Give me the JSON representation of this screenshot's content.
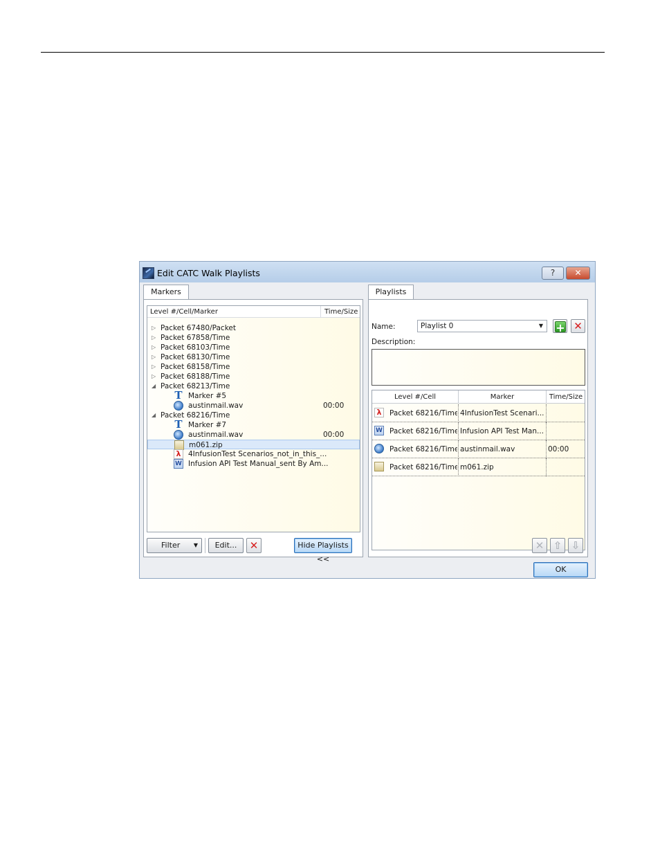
{
  "window": {
    "title": "Edit CATC Walk Playlists",
    "help_label": "?",
    "close_label": "✕"
  },
  "markers_panel": {
    "tab_label": "Markers",
    "columns": [
      "Level #/Cell/Marker",
      "Time/Size"
    ],
    "tree": [
      {
        "label": "Packet 67480/Packet",
        "kind": "collapsed",
        "time": ""
      },
      {
        "label": "Packet 67858/Time",
        "kind": "collapsed",
        "time": ""
      },
      {
        "label": "Packet 68103/Time",
        "kind": "collapsed",
        "time": ""
      },
      {
        "label": "Packet 68130/Time",
        "kind": "collapsed",
        "time": ""
      },
      {
        "label": "Packet 68158/Time",
        "kind": "collapsed",
        "time": ""
      },
      {
        "label": "Packet 68188/Time",
        "kind": "collapsed",
        "time": ""
      },
      {
        "label": "Packet 68213/Time",
        "kind": "expanded",
        "time": ""
      },
      {
        "label": "Marker #5",
        "kind": "text",
        "time": ""
      },
      {
        "label": "austinmail.wav",
        "kind": "audio",
        "time": "00:00"
      },
      {
        "label": "Packet 68216/Time",
        "kind": "expanded",
        "time": ""
      },
      {
        "label": "Marker #7",
        "kind": "text",
        "time": ""
      },
      {
        "label": "austinmail.wav",
        "kind": "audio",
        "time": "00:00"
      },
      {
        "label": "m061.zip",
        "kind": "zip",
        "time": "",
        "selected": true
      },
      {
        "label": "4InfusionTest Scenarios_not_in_this_...",
        "kind": "pdf",
        "time": ""
      },
      {
        "label": "Infusion API Test Manual_sent By Am...",
        "kind": "doc",
        "time": ""
      }
    ],
    "filter_label": "Filter",
    "edit_label": "Edit...",
    "hide_playlists_label": "Hide Playlists <<"
  },
  "playlists_panel": {
    "tab_label": "Playlists",
    "name_label": "Name:",
    "name_value": "Playlist 0",
    "description_label": "Description:",
    "description_value": "",
    "columns": [
      "Level #/Cell",
      "Marker",
      "Time/Size"
    ],
    "rows": [
      {
        "icon": "pdf",
        "level": "Packet 68216/Time",
        "marker": "4InfusionTest Scenari...",
        "time": ""
      },
      {
        "icon": "doc",
        "level": "Packet 68216/Time",
        "marker": "Infusion API Test Man...",
        "time": ""
      },
      {
        "icon": "audio",
        "level": "Packet 68216/Time",
        "marker": "austinmail.wav",
        "time": "00:00"
      },
      {
        "icon": "zip",
        "level": "Packet 68216/Time",
        "marker": "m061.zip",
        "time": ""
      }
    ]
  },
  "ok_label": "OK"
}
